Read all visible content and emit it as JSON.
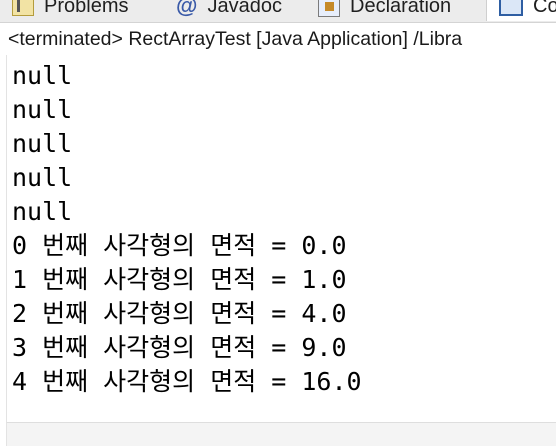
{
  "tabs": [
    {
      "label": "Problems",
      "icon": "problems-icon"
    },
    {
      "label": "Javadoc",
      "icon": "javadoc-icon"
    },
    {
      "label": "Declaration",
      "icon": "declaration-icon"
    },
    {
      "label": "Co",
      "icon": "console-icon"
    }
  ],
  "console": {
    "status": "<terminated> RectArrayTest [Java Application] /Libra",
    "lines": [
      "null",
      "null",
      "null",
      "null",
      "null",
      "0 번째 사각형의 면적 = 0.0",
      "1 번째 사각형의 면적 = 1.0",
      "2 번째 사각형의 면적 = 4.0",
      "3 번째 사각형의 면적 = 9.0",
      "4 번째 사각형의 면적 = 16.0"
    ]
  }
}
